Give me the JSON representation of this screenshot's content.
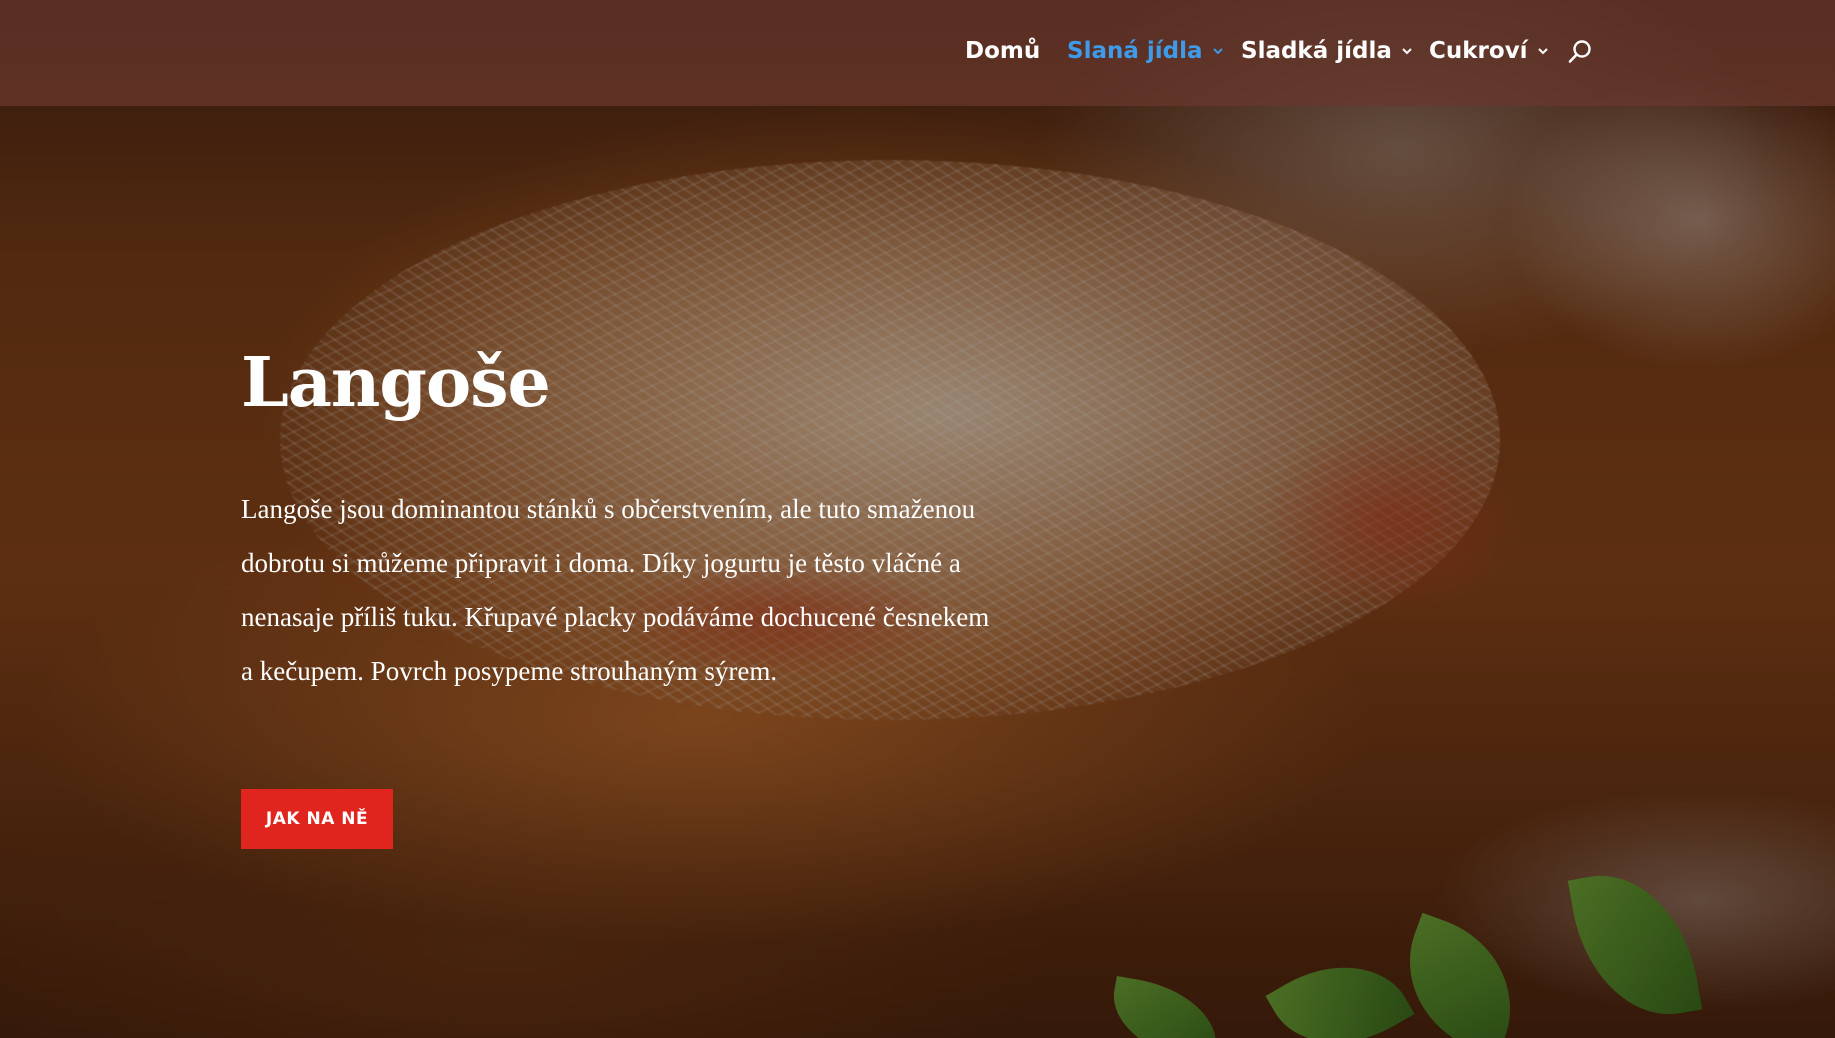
{
  "nav": {
    "items": [
      {
        "label": "Domů",
        "active": false,
        "has_dropdown": false
      },
      {
        "label": "Slaná jídla",
        "active": true,
        "has_dropdown": true
      },
      {
        "label": "Sladká jídla",
        "active": false,
        "has_dropdown": true
      },
      {
        "label": "Cukroví",
        "active": false,
        "has_dropdown": true
      }
    ],
    "search_icon": "search-icon",
    "active_color": "#3d9be9"
  },
  "hero": {
    "title": "Langoše",
    "text": "Langoše jsou dominantou stánků s občerstvením, ale tuto smaženou dobrotu si můžeme připravit i doma. Díky jogurtu je těsto vláčné a nenasaje příliš tuku. Křupavé placky podáváme dochucené česnekem a kečupem. Povrch posypeme strouhaným sýrem.",
    "cta_label": "JAK NA NĚ",
    "cta_color": "#e0251f"
  }
}
